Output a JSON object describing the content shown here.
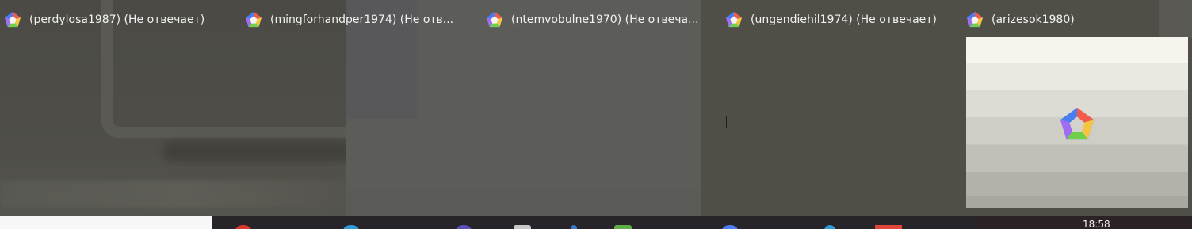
{
  "thumbnails": [
    {
      "title": "(perdylosa1987) (Не отвечает)",
      "icon": "pentagon-app-icon"
    },
    {
      "title": "(mingforhandper1974) (Не отв...",
      "icon": "pentagon-app-icon"
    },
    {
      "title": "(ntemvobulne1970) (Не отвеча...",
      "icon": "pentagon-app-icon"
    },
    {
      "title": "(ungendiehil1974) (Не отвечает)",
      "icon": "pentagon-app-icon"
    },
    {
      "title": "(arizesok1980)",
      "icon": "pentagon-app-icon"
    }
  ],
  "taskbar": {
    "clock": "18:58"
  },
  "colors": {
    "icon_blue": "#4a7df2",
    "icon_red": "#f25a4a",
    "icon_yellow": "#f5c542",
    "icon_green": "#6fd14b",
    "icon_purple": "#a06cf0"
  }
}
